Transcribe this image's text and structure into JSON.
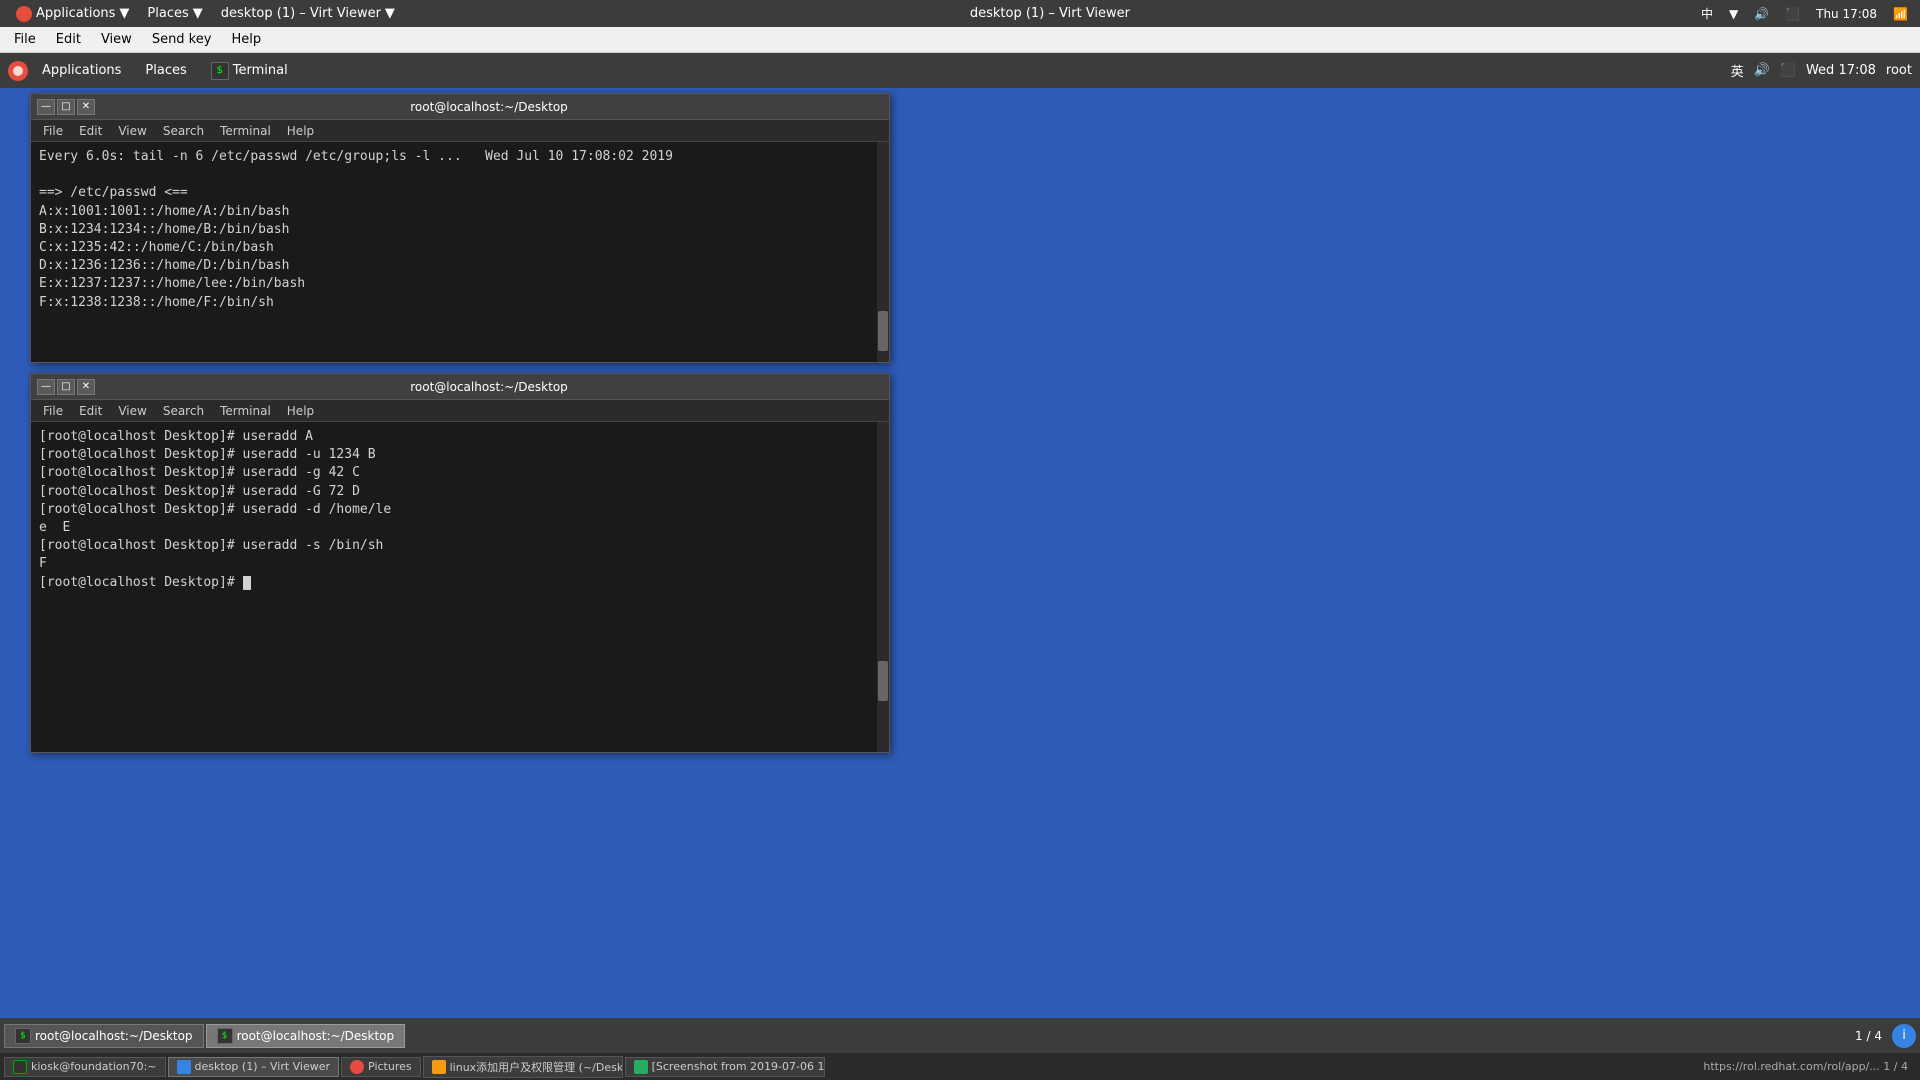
{
  "host": {
    "topbar": {
      "app_menu": "Applications",
      "places_menu": "Places",
      "active_window": "desktop (1) – Virt Viewer",
      "title": "desktop (1) – Virt Viewer",
      "time": "Thu 17:08",
      "lang": "中",
      "arrow": "▼"
    },
    "menubar": {
      "items": [
        "File",
        "Edit",
        "View",
        "Send key",
        "Help"
      ]
    },
    "taskbar": {
      "items": [
        {
          "label": "kiosk@foundation70:~",
          "type": "terminal",
          "active": false
        },
        {
          "label": "desktop (1) – Virt Viewer",
          "type": "viewer",
          "active": true
        },
        {
          "label": "Pictures",
          "type": "pictures",
          "active": false
        },
        {
          "label": "linux添加用户及权限管理 (~/Desktop...",
          "type": "linux-doc",
          "active": false
        },
        {
          "label": "[Screenshot from 2019-07-06 1...",
          "type": "screenshot",
          "active": false
        }
      ],
      "right_info": "https://rol.redhat.com/rol/app/..."
    }
  },
  "virt_viewer": {
    "title": "desktop (1) – Virt Viewer",
    "window_controls": {
      "minimize": "—",
      "maximize": "□",
      "close": "✕"
    }
  },
  "guest": {
    "panel": {
      "applications": "Applications",
      "places": "Places",
      "terminal": "Terminal",
      "lang": "英",
      "time": "Wed 17:08",
      "user": "root"
    },
    "terminal1": {
      "title": "root@localhost:~/Desktop",
      "content_lines": [
        "Every 6.0s: tail -n 6 /etc/passwd /etc/group;ls -l ...   Wed Jul 10 17:08:02 2019",
        "",
        "==> /etc/passwd <==",
        "A:x:1001:1001::/home/A:/bin/bash",
        "B:x:1234:1234::/home/B:/bin/bash",
        "C:x:1235:42::/home/C:/bin/bash",
        "D:x:1236:1236::/home/D:/bin/bash",
        "E:x:1237:1237::/home/lee:/bin/bash",
        "F:x:1238:1238::/home/F:/bin/sh"
      ],
      "menu": [
        "File",
        "Edit",
        "View",
        "Search",
        "Terminal",
        "Help"
      ]
    },
    "terminal2": {
      "title": "root@localhost:~/Desktop",
      "content_lines": [
        "[root@localhost Desktop]# useradd A",
        "[root@localhost Desktop]# useradd -u 1234 B",
        "[root@localhost Desktop]# useradd -g 42 C",
        "[root@localhost Desktop]# useradd -G 72 D",
        "[root@localhost Desktop]# useradd -d /home/le",
        "e  E",
        "[root@localhost Desktop]# useradd -s /bin/sh",
        "F",
        "[root@localhost Desktop]# "
      ],
      "menu": [
        "File",
        "Edit",
        "View",
        "Search",
        "Terminal",
        "Help"
      ]
    },
    "taskbar": {
      "items": [
        {
          "label": "root@localhost:~/Desktop",
          "active": false
        },
        {
          "label": "root@localhost:~/Desktop",
          "active": true
        }
      ],
      "pager": "1 / 4"
    }
  }
}
